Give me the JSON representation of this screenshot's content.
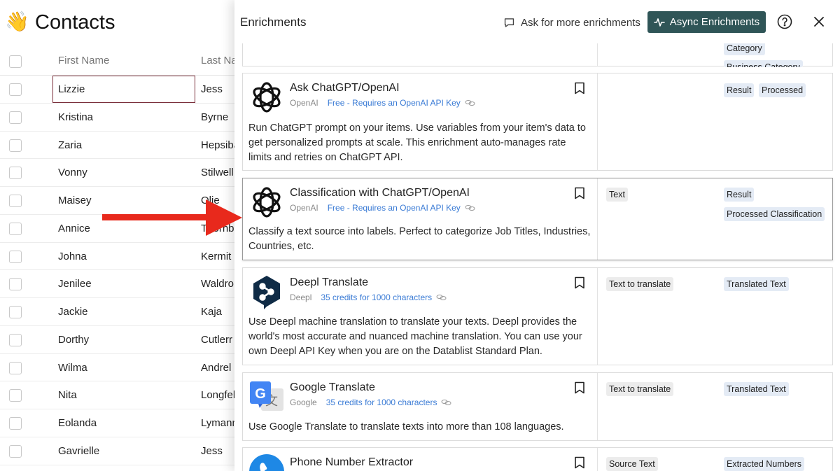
{
  "contacts": {
    "emoji": "👋",
    "title": "Contacts",
    "columns": {
      "first": "First Name",
      "last": "Last Na"
    },
    "rows": [
      {
        "first": "Lizzie",
        "last": "Jess"
      },
      {
        "first": "Kristina",
        "last": "Byrne"
      },
      {
        "first": "Zaria",
        "last": "Hepsiba"
      },
      {
        "first": "Vonny",
        "last": "Stilwell"
      },
      {
        "first": "Maisey",
        "last": "Olie"
      },
      {
        "first": "Annice",
        "last": "Thornbu"
      },
      {
        "first": "Johna",
        "last": "Kermit"
      },
      {
        "first": "Jenilee",
        "last": "Waldron"
      },
      {
        "first": "Jackie",
        "last": "Kaja"
      },
      {
        "first": "Dorthy",
        "last": "Cutlerr"
      },
      {
        "first": "Wilma",
        "last": "Andrel"
      },
      {
        "first": "Nita",
        "last": "Longfel"
      },
      {
        "first": "Eolanda",
        "last": "Lymann"
      },
      {
        "first": "Gavrielle",
        "last": "Jess"
      }
    ]
  },
  "panel": {
    "title": "Enrichments",
    "ask_label": "Ask for more enrichments",
    "async_label": "Async Enrichments",
    "top_partial_tags": [
      "Category",
      "Business Category"
    ],
    "cards": [
      {
        "name": "Ask ChatGPT/OpenAI",
        "provider": "OpenAI",
        "price": "Free - Requires an OpenAI API Key",
        "desc": "Run ChatGPT prompt on your items. Use variables from your item's data to get personalized prompts at scale. This enrichment auto-manages rate limits and retries on ChatGPT API.",
        "inputs": [],
        "outputs": [
          "Result",
          "Processed"
        ]
      },
      {
        "name": "Classification with ChatGPT/OpenAI",
        "provider": "OpenAI",
        "price": "Free - Requires an OpenAI API Key",
        "desc": "Classify a text source into labels. Perfect to categorize Job Titles, Industries, Countries, etc.",
        "inputs": [
          "Text"
        ],
        "outputs": [
          "Result",
          "Processed Classification"
        ]
      },
      {
        "name": "Deepl Translate",
        "provider": "Deepl",
        "price": "35 credits for 1000 characters",
        "desc": "Use Deepl machine translation to translate your texts. Deepl provides the world's most accurate and nuanced machine translation. You can use your own Deepl API Key when you are on the Datablist Standard Plan.",
        "inputs": [
          "Text to translate"
        ],
        "outputs": [
          "Translated Text"
        ]
      },
      {
        "name": "Google Translate",
        "provider": "Google",
        "price": "35 credits for 1000 characters",
        "desc": "Use Google Translate to translate texts into more than 108 languages.",
        "inputs": [
          "Text to translate"
        ],
        "outputs": [
          "Translated Text"
        ]
      },
      {
        "name": "Phone Number Extractor",
        "provider": "",
        "price": "",
        "desc": "",
        "inputs": [
          "Source Text"
        ],
        "outputs": [
          "Extracted Numbers"
        ]
      }
    ]
  },
  "colors": {
    "async_button": "#2f5557",
    "link_blue": "#3a7bd5",
    "arrow_red": "#e8291c",
    "selected_cell_border": "#7a2e3a"
  }
}
